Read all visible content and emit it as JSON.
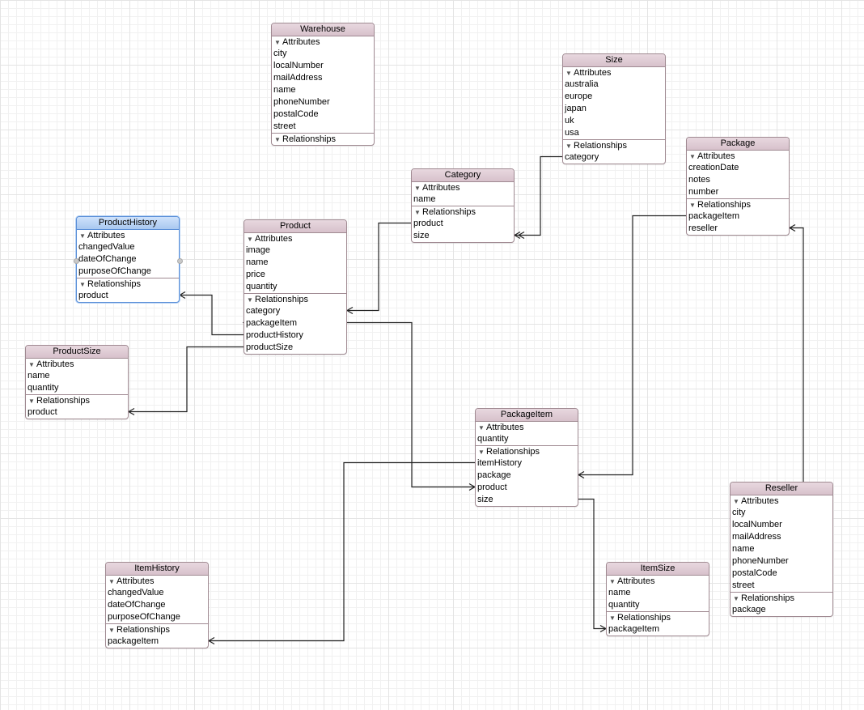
{
  "entities": [
    {
      "id": "warehouse",
      "name": "Warehouse",
      "attributes_label": "Attributes",
      "attributes": [
        "city",
        "localNumber",
        "mailAddress",
        "name",
        "phoneNumber",
        "postalCode",
        "street"
      ],
      "relationships_label": "Relationships",
      "relationships": []
    },
    {
      "id": "size",
      "name": "Size",
      "attributes_label": "Attributes",
      "attributes": [
        "australia",
        "europe",
        "japan",
        "uk",
        "usa"
      ],
      "relationships_label": "Relationships",
      "relationships": [
        "category"
      ]
    },
    {
      "id": "package",
      "name": "Package",
      "attributes_label": "Attributes",
      "attributes": [
        "creationDate",
        "notes",
        "number"
      ],
      "relationships_label": "Relationships",
      "relationships": [
        "packageItem",
        "reseller"
      ]
    },
    {
      "id": "category",
      "name": "Category",
      "attributes_label": "Attributes",
      "attributes": [
        "name"
      ],
      "relationships_label": "Relationships",
      "relationships": [
        "product",
        "size"
      ]
    },
    {
      "id": "producthistory",
      "name": "ProductHistory",
      "selected": true,
      "attributes_label": "Attributes",
      "attributes": [
        "changedValue",
        "dateOfChange",
        "purposeOfChange"
      ],
      "relationships_label": "Relationships",
      "relationships": [
        "product"
      ]
    },
    {
      "id": "product",
      "name": "Product",
      "attributes_label": "Attributes",
      "attributes": [
        "image",
        "name",
        "price",
        "quantity"
      ],
      "relationships_label": "Relationships",
      "relationships": [
        "category",
        "packageItem",
        "productHistory",
        "productSize"
      ]
    },
    {
      "id": "productsize",
      "name": "ProductSize",
      "attributes_label": "Attributes",
      "attributes": [
        "name",
        "quantity"
      ],
      "relationships_label": "Relationships",
      "relationships": [
        "product"
      ]
    },
    {
      "id": "packageitem",
      "name": "PackageItem",
      "attributes_label": "Attributes",
      "attributes": [
        "quantity"
      ],
      "relationships_label": "Relationships",
      "relationships": [
        "itemHistory",
        "package",
        "product",
        "size"
      ]
    },
    {
      "id": "reseller",
      "name": "Reseller",
      "attributes_label": "Attributes",
      "attributes": [
        "city",
        "localNumber",
        "mailAddress",
        "name",
        "phoneNumber",
        "postalCode",
        "street"
      ],
      "relationships_label": "Relationships",
      "relationships": [
        "package"
      ]
    },
    {
      "id": "itemhistory",
      "name": "ItemHistory",
      "attributes_label": "Attributes",
      "attributes": [
        "changedValue",
        "dateOfChange",
        "purposeOfChange"
      ],
      "relationships_label": "Relationships",
      "relationships": [
        "packageItem"
      ]
    },
    {
      "id": "itemsize",
      "name": "ItemSize",
      "attributes_label": "Attributes",
      "attributes": [
        "name",
        "quantity"
      ],
      "relationships_label": "Relationships",
      "relationships": [
        "packageItem"
      ]
    }
  ],
  "relationships": [
    {
      "from": "Size.category",
      "to": "Category.size",
      "from_cardinality": "to-one",
      "to_cardinality": "to-many"
    },
    {
      "from": "Category.product",
      "to": "Product.category",
      "from_cardinality": "to-many",
      "to_cardinality": "to-one"
    },
    {
      "from": "Product.productHistory",
      "to": "ProductHistory.product",
      "from_cardinality": "to-many",
      "to_cardinality": "to-one"
    },
    {
      "from": "Product.productSize",
      "to": "ProductSize.product",
      "from_cardinality": "to-many",
      "to_cardinality": "to-one"
    },
    {
      "from": "Product.packageItem",
      "to": "PackageItem.product",
      "from_cardinality": "to-many",
      "to_cardinality": "to-one"
    },
    {
      "from": "Package.packageItem",
      "to": "PackageItem.package",
      "from_cardinality": "to-many",
      "to_cardinality": "to-one"
    },
    {
      "from": "Package.reseller",
      "to": "Reseller.package",
      "from_cardinality": "to-one",
      "to_cardinality": "to-many"
    },
    {
      "from": "PackageItem.itemHistory",
      "to": "ItemHistory.packageItem",
      "from_cardinality": "to-many",
      "to_cardinality": "to-one"
    },
    {
      "from": "PackageItem.size",
      "to": "ItemSize.packageItem",
      "from_cardinality": "to-many",
      "to_cardinality": "to-one"
    }
  ],
  "colors": {
    "header": "#d9c4ce",
    "border": "#a08a92",
    "selected_header": "#b7d2f4",
    "line": "#222222"
  }
}
